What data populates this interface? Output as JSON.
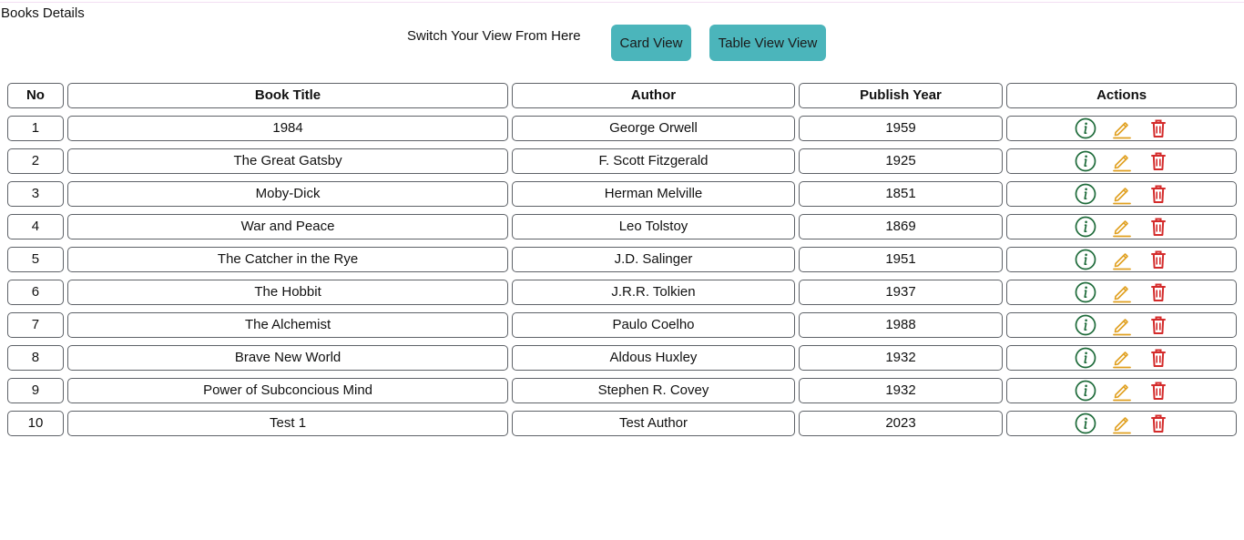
{
  "page": {
    "title": "Books Details"
  },
  "view_switch": {
    "label": "Switch Your View From Here",
    "card_button": "Card View",
    "table_button": "Table View View"
  },
  "table": {
    "headers": [
      "No",
      "Book Title",
      "Author",
      "Publish Year",
      "Actions"
    ],
    "rows": [
      {
        "no": "1",
        "title": "1984",
        "author": "George Orwell",
        "year": "1959"
      },
      {
        "no": "2",
        "title": "The Great Gatsby",
        "author": "F. Scott Fitzgerald",
        "year": "1925"
      },
      {
        "no": "3",
        "title": "Moby-Dick",
        "author": "Herman Melville",
        "year": "1851"
      },
      {
        "no": "4",
        "title": "War and Peace",
        "author": "Leo Tolstoy",
        "year": "1869"
      },
      {
        "no": "5",
        "title": "The Catcher in the Rye",
        "author": "J.D. Salinger",
        "year": "1951"
      },
      {
        "no": "6",
        "title": "The Hobbit",
        "author": "J.R.R. Tolkien",
        "year": "1937"
      },
      {
        "no": "7",
        "title": "The Alchemist",
        "author": "Paulo Coelho",
        "year": "1988"
      },
      {
        "no": "8",
        "title": "Brave New World",
        "author": "Aldous Huxley",
        "year": "1932"
      },
      {
        "no": "9",
        "title": "Power of Subconcious Mind",
        "author": "Stephen R. Covey",
        "year": "1932"
      },
      {
        "no": "10",
        "title": "Test 1",
        "author": "Test Author",
        "year": "2023"
      }
    ],
    "row_actions": [
      {
        "name": "info-icon",
        "color": "#1e6b3a"
      },
      {
        "name": "edit-icon",
        "color": "#e0a020"
      },
      {
        "name": "delete-icon",
        "color": "#d42b2b"
      }
    ]
  },
  "colors": {
    "button_bg": "#4bb5bb",
    "cell_border": "#5e6268"
  }
}
